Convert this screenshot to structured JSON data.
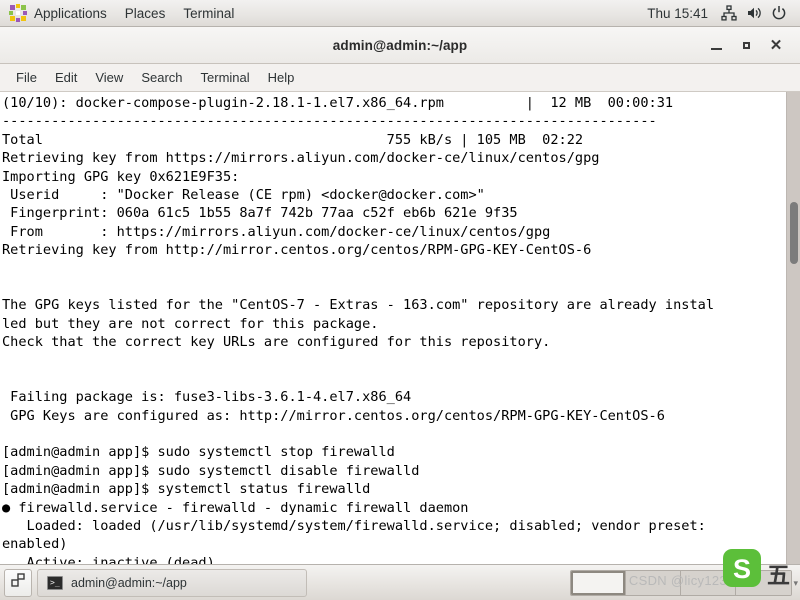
{
  "top_panel": {
    "app_logo_name": "centos-logo-icon",
    "menus": [
      {
        "label": "Applications",
        "name": "applications-menu"
      },
      {
        "label": "Places",
        "name": "places-menu"
      },
      {
        "label": "Terminal",
        "name": "terminal-menu"
      }
    ],
    "clock": "Thu 15:41",
    "tray": [
      {
        "name": "network-icon",
        "glyph": "network"
      },
      {
        "name": "volume-icon",
        "glyph": "volume"
      },
      {
        "name": "power-icon",
        "glyph": "power"
      }
    ]
  },
  "window": {
    "title": "admin@admin:~/app",
    "buttons": {
      "minimize": "_",
      "maximize": "□",
      "close": "✕"
    },
    "menubar": [
      "File",
      "Edit",
      "View",
      "Search",
      "Terminal",
      "Help"
    ]
  },
  "terminal": {
    "lines": [
      "(10/10): docker-compose-plugin-2.18.1-1.el7.x86_64.rpm          |  12 MB  00:00:31",
      "--------------------------------------------------------------------------------",
      "Total                                          755 kB/s | 105 MB  02:22",
      "Retrieving key from https://mirrors.aliyun.com/docker-ce/linux/centos/gpg",
      "Importing GPG key 0x621E9F35:",
      " Userid     : \"Docker Release (CE rpm) <docker@docker.com>\"",
      " Fingerprint: 060a 61c5 1b55 8a7f 742b 77aa c52f eb6b 621e 9f35",
      " From       : https://mirrors.aliyun.com/docker-ce/linux/centos/gpg",
      "Retrieving key from http://mirror.centos.org/centos/RPM-GPG-KEY-CentOS-6",
      "",
      "",
      "The GPG keys listed for the \"CentOS-7 - Extras - 163.com\" repository are already instal",
      "led but they are not correct for this package.",
      "Check that the correct key URLs are configured for this repository.",
      "",
      "",
      " Failing package is: fuse3-libs-3.6.1-4.el7.x86_64",
      " GPG Keys are configured as: http://mirror.centos.org/centos/RPM-GPG-KEY-CentOS-6",
      "",
      "[admin@admin app]$ sudo systemctl stop firewalld",
      "[admin@admin app]$ sudo systemctl disable firewalld",
      "[admin@admin app]$ systemctl status firewalld",
      "● firewalld.service - firewalld - dynamic firewall daemon",
      "   Loaded: loaded (/usr/lib/systemd/system/firewalld.service; disabled; vendor preset:",
      "enabled)",
      "   Active: inactive (dead)"
    ],
    "scrollbar_name": "terminal-scrollbar"
  },
  "taskbar": {
    "show_desktop_name": "show-desktop-button",
    "tasks": [
      {
        "label": "admin@admin:~/app",
        "icon": "terminal-icon"
      }
    ],
    "workspaces": [
      {
        "active": true
      },
      {
        "active": false
      },
      {
        "active": false
      },
      {
        "active": false
      }
    ]
  },
  "watermark": {
    "text": "CSDN @licy12306",
    "ime_char": "五",
    "ime_logo_letter": "S",
    "ime_caret": "▾"
  },
  "colors": {
    "panel_bg": "#e8e6e3",
    "terminal_bg": "#ffffff",
    "terminal_fg": "#000000",
    "scrollbar_track": "#cdc7c2",
    "scrollbar_thumb": "#7c7c7c",
    "ime_green": "#5cbf3a"
  }
}
